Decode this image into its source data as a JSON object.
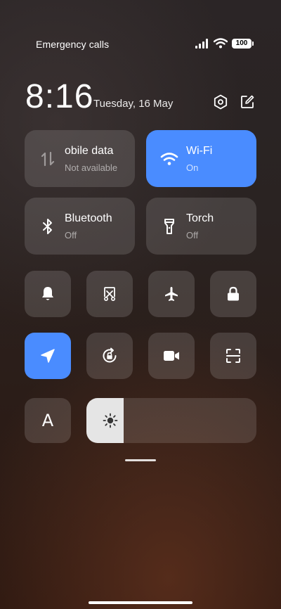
{
  "status_bar": {
    "carrier_text": "Emergency calls",
    "battery_level": "100"
  },
  "header": {
    "time": "8:16",
    "date": "Tuesday, 16 May",
    "settings_icon": "hexagon-gear-icon",
    "edit_icon": "edit-icon"
  },
  "tiles": {
    "mobile_data": {
      "title": "obile data",
      "subtitle": "Not available",
      "icon": "mobile-data-icon",
      "active": false
    },
    "wifi": {
      "title": "Wi-Fi",
      "subtitle": "On",
      "icon": "wifi-icon",
      "active": true,
      "color": "#4a8cff"
    },
    "bluetooth": {
      "title": "Bluetooth",
      "subtitle": "Off",
      "icon": "bluetooth-icon",
      "active": false
    },
    "torch": {
      "title": "Torch",
      "subtitle": "Off",
      "icon": "torch-icon",
      "active": false
    }
  },
  "toggles": [
    {
      "name": "silent",
      "icon": "bell-icon",
      "active": false
    },
    {
      "name": "screenshot",
      "icon": "scissors-screenshot-icon",
      "active": false
    },
    {
      "name": "airplane-mode",
      "icon": "airplane-icon",
      "active": false
    },
    {
      "name": "lock-screen",
      "icon": "lock-icon",
      "active": false
    },
    {
      "name": "location",
      "icon": "location-arrow-icon",
      "active": true
    },
    {
      "name": "rotation-lock",
      "icon": "rotation-lock-icon",
      "active": false
    },
    {
      "name": "screen-record",
      "icon": "video-camera-icon",
      "active": false
    },
    {
      "name": "scanner",
      "icon": "scan-icon",
      "active": false
    }
  ],
  "auto_brightness": {
    "label": "A"
  },
  "brightness": {
    "level": 0.22,
    "icon": "sun-icon"
  }
}
